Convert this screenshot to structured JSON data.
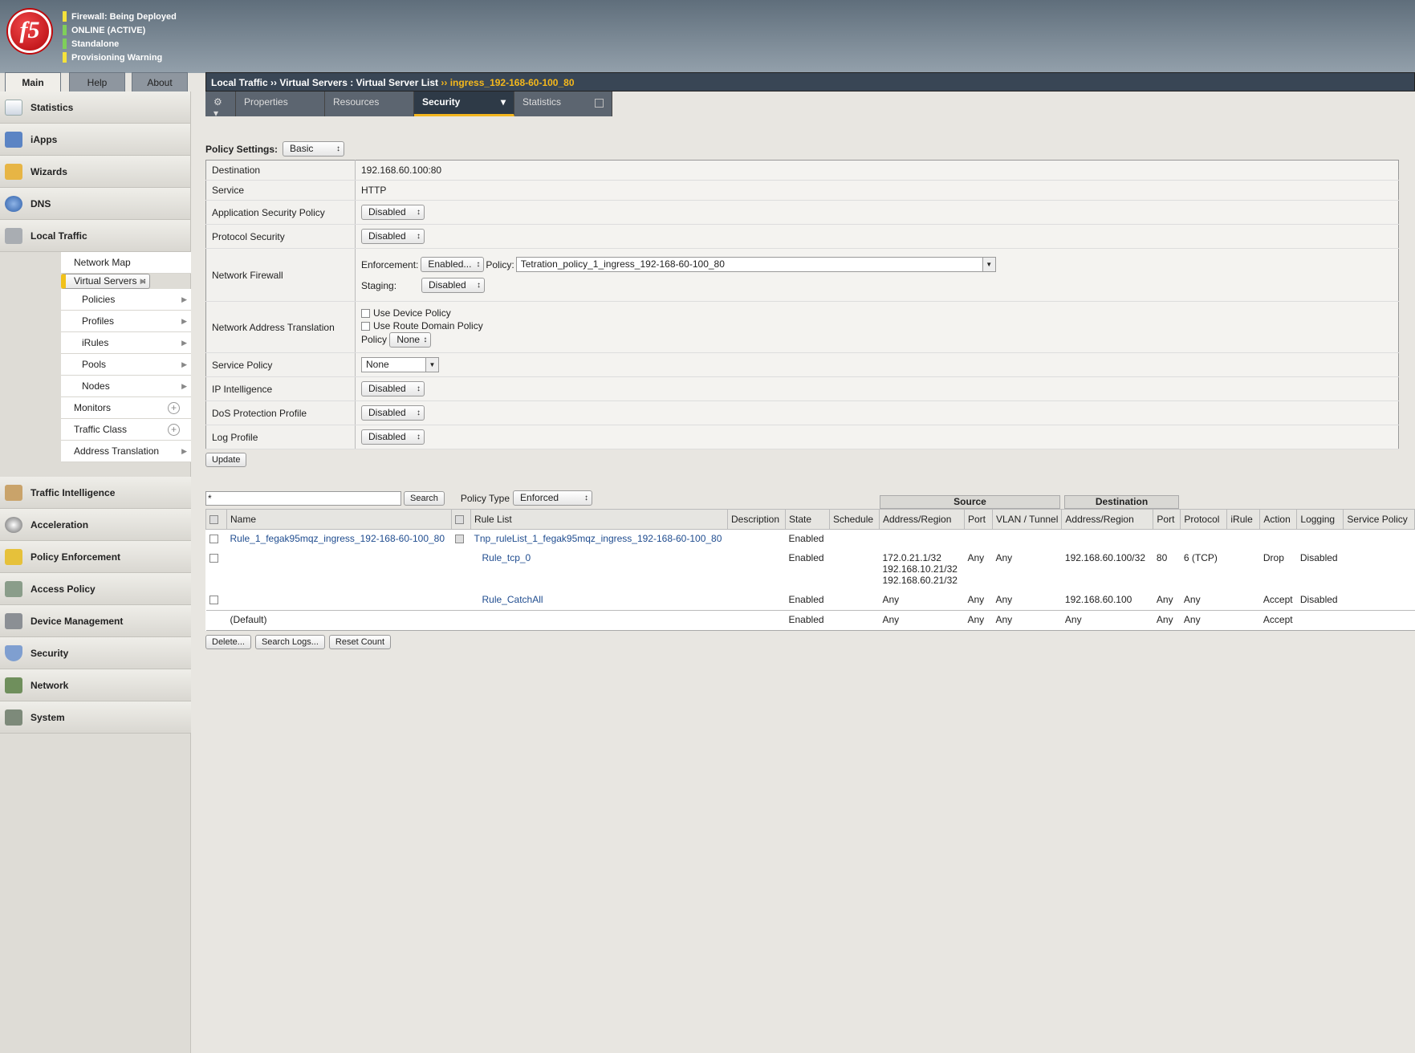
{
  "header": {
    "logo": "f5",
    "status": [
      {
        "text": "Firewall: Being Deployed",
        "color": "#f5e23b"
      },
      {
        "text": "ONLINE (ACTIVE)",
        "color": "#7fcf5a"
      },
      {
        "text": "Standalone",
        "color": "#7fcf5a"
      },
      {
        "text": "Provisioning Warning",
        "color": "#f5e23b"
      }
    ]
  },
  "main_tabs": [
    "Main",
    "Help",
    "About"
  ],
  "sidebar": {
    "sections": [
      "Statistics",
      "iApps",
      "Wizards",
      "DNS",
      "Local Traffic"
    ],
    "local_traffic_items": [
      "Network Map",
      "Virtual Servers",
      "Policies",
      "Profiles",
      "iRules",
      "Pools",
      "Nodes",
      "Monitors",
      "Traffic Class",
      "Address Translation"
    ],
    "lower_sections": [
      "Traffic Intelligence",
      "Acceleration",
      "Policy Enforcement",
      "Access Policy",
      "Device Management",
      "Security",
      "Network",
      "System"
    ]
  },
  "breadcrumb": {
    "part1": "Local Traffic",
    "sep": "››",
    "part2": "Virtual Servers : Virtual Server List",
    "part3": "ingress_192-168-60-100_80"
  },
  "page_tabs": {
    "gear": "⚙",
    "properties": "Properties",
    "resources": "Resources",
    "security": "Security",
    "statistics": "Statistics"
  },
  "policy_settings": {
    "label": "Policy Settings:",
    "value": "Basic"
  },
  "props": {
    "destination_label": "Destination",
    "destination": "192.168.60.100:80",
    "service_label": "Service",
    "service": "HTTP",
    "asp_label": "Application Security Policy",
    "asp": "Disabled",
    "protocol_security_label": "Protocol Security",
    "protocol_security": "Disabled",
    "nf_label": "Network Firewall",
    "enforcement_label": "Enforcement:",
    "enforcement": "Enabled...",
    "policy_label": "Policy:",
    "policy": "Tetration_policy_1_ingress_192-168-60-100_80",
    "staging_label": "Staging:",
    "staging": "Disabled",
    "nat_label": "Network Address Translation",
    "use_device_policy": "Use Device Policy",
    "use_route_domain_policy": "Use Route Domain Policy",
    "nat_policy_label": "Policy",
    "nat_policy": "None",
    "service_policy_label": "Service Policy",
    "service_policy": "None",
    "ip_intel_label": "IP Intelligence",
    "ip_intel": "Disabled",
    "dos_label": "DoS Protection Profile",
    "dos": "Disabled",
    "log_label": "Log Profile",
    "log": "Disabled",
    "update": "Update"
  },
  "filter": {
    "search_value": "*",
    "search_button": "Search",
    "policy_type_label": "Policy Type",
    "policy_type": "Enforced",
    "source": "Source",
    "destination": "Destination"
  },
  "columns": [
    "Name",
    "Rule List",
    "Description",
    "State",
    "Schedule",
    "Address/Region",
    "Port",
    "VLAN / Tunnel",
    "Address/Region",
    "Port",
    "Protocol",
    "iRule",
    "Action",
    "Logging",
    "Service Policy"
  ],
  "rows": [
    {
      "name": "Rule_1_fegak95mqz_ingress_192-168-60-100_80",
      "rulelist": "Tnp_ruleList_1_fegak95mqz_ingress_192-168-60-100_80",
      "state": "Enabled",
      "src": "",
      "sport": "",
      "vlan": "",
      "dst": "",
      "dport": "",
      "proto": "",
      "action": "",
      "logging": ""
    },
    {
      "name": "",
      "rulelist": "Rule_tcp_0",
      "state": "Enabled",
      "src": "172.0.21.1/32\n192.168.10.21/32\n192.168.60.21/32",
      "sport": "Any",
      "vlan": "Any",
      "dst": "192.168.60.100/32",
      "dport": "80",
      "proto": "6 (TCP)",
      "action": "Drop",
      "logging": "Disabled"
    },
    {
      "name": "",
      "rulelist": "Rule_CatchAll",
      "state": "Enabled",
      "src": "Any",
      "sport": "Any",
      "vlan": "Any",
      "dst": "192.168.60.100",
      "dport": "Any",
      "proto": "Any",
      "action": "Accept",
      "logging": "Disabled"
    },
    {
      "name": "(Default)",
      "rulelist": "",
      "state": "Enabled",
      "src": "Any",
      "sport": "Any",
      "vlan": "Any",
      "dst": "Any",
      "dport": "Any",
      "proto": "Any",
      "action": "Accept",
      "logging": ""
    }
  ],
  "bottom_buttons": [
    "Delete...",
    "Search Logs...",
    "Reset Count"
  ]
}
